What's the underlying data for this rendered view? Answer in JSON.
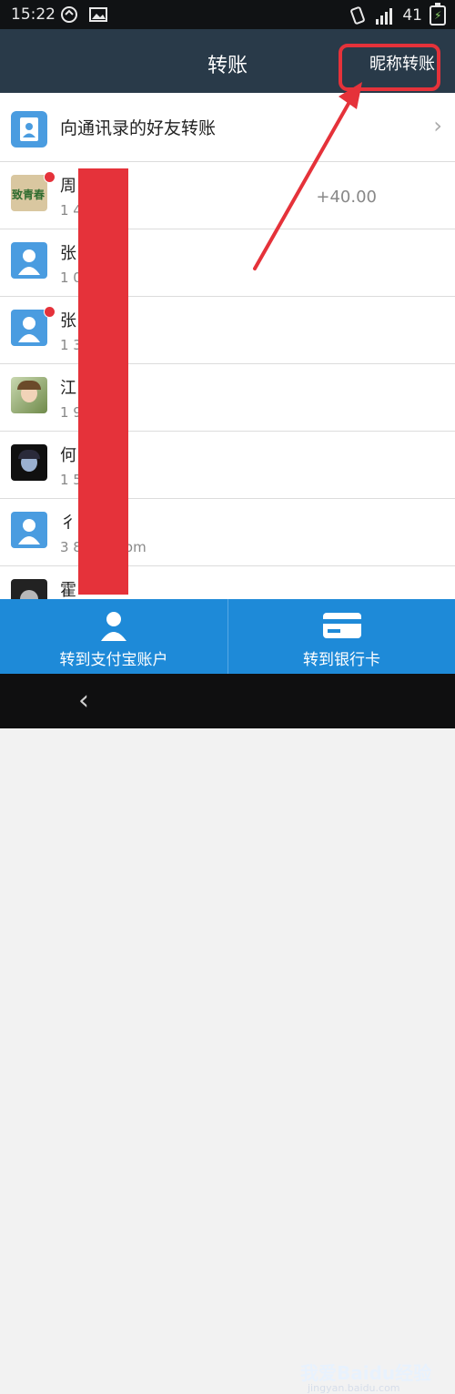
{
  "status": {
    "time": "15:22",
    "signal_label": "41",
    "icons": [
      "sync-icon",
      "image-icon",
      "vibrate-icon",
      "signal-icon",
      "battery-charging-icon"
    ]
  },
  "header": {
    "title": "转账",
    "nickname_transfer": "昵称转账"
  },
  "address_book": {
    "label": "向通讯录的好友转账"
  },
  "contacts": [
    {
      "name": "周",
      "sub": "1         41",
      "amount": "+40.00",
      "avatar": "致青春",
      "dot": true
    },
    {
      "name": "张",
      "sub": "1         08",
      "amount": "",
      "avatar": "default",
      "dot": false
    },
    {
      "name": "张",
      "sub": "1         314",
      "amount": "",
      "avatar": "default",
      "dot": true
    },
    {
      "name": "江",
      "sub": "1         91",
      "amount": "",
      "avatar": "photo",
      "dot": false
    },
    {
      "name": "何",
      "sub": "1         55",
      "amount": "",
      "avatar": "photo-dark",
      "dot": false
    },
    {
      "name": "彳",
      "sub": "3         8@qq.com",
      "amount": "",
      "avatar": "default",
      "dot": false
    },
    {
      "name": "霍",
      "sub": "",
      "amount": "",
      "avatar": "photo-dark",
      "dot": false
    }
  ],
  "bottom": {
    "to_alipay": "转到支付宝账户",
    "to_bank": "转到银行卡"
  },
  "watermark": {
    "text": "我爱Baidu经验",
    "url": "jingyan.baidu.com"
  },
  "colors": {
    "header": "#293a49",
    "bottom_bar": "#1e8ad8",
    "highlight": "#e5323a"
  }
}
